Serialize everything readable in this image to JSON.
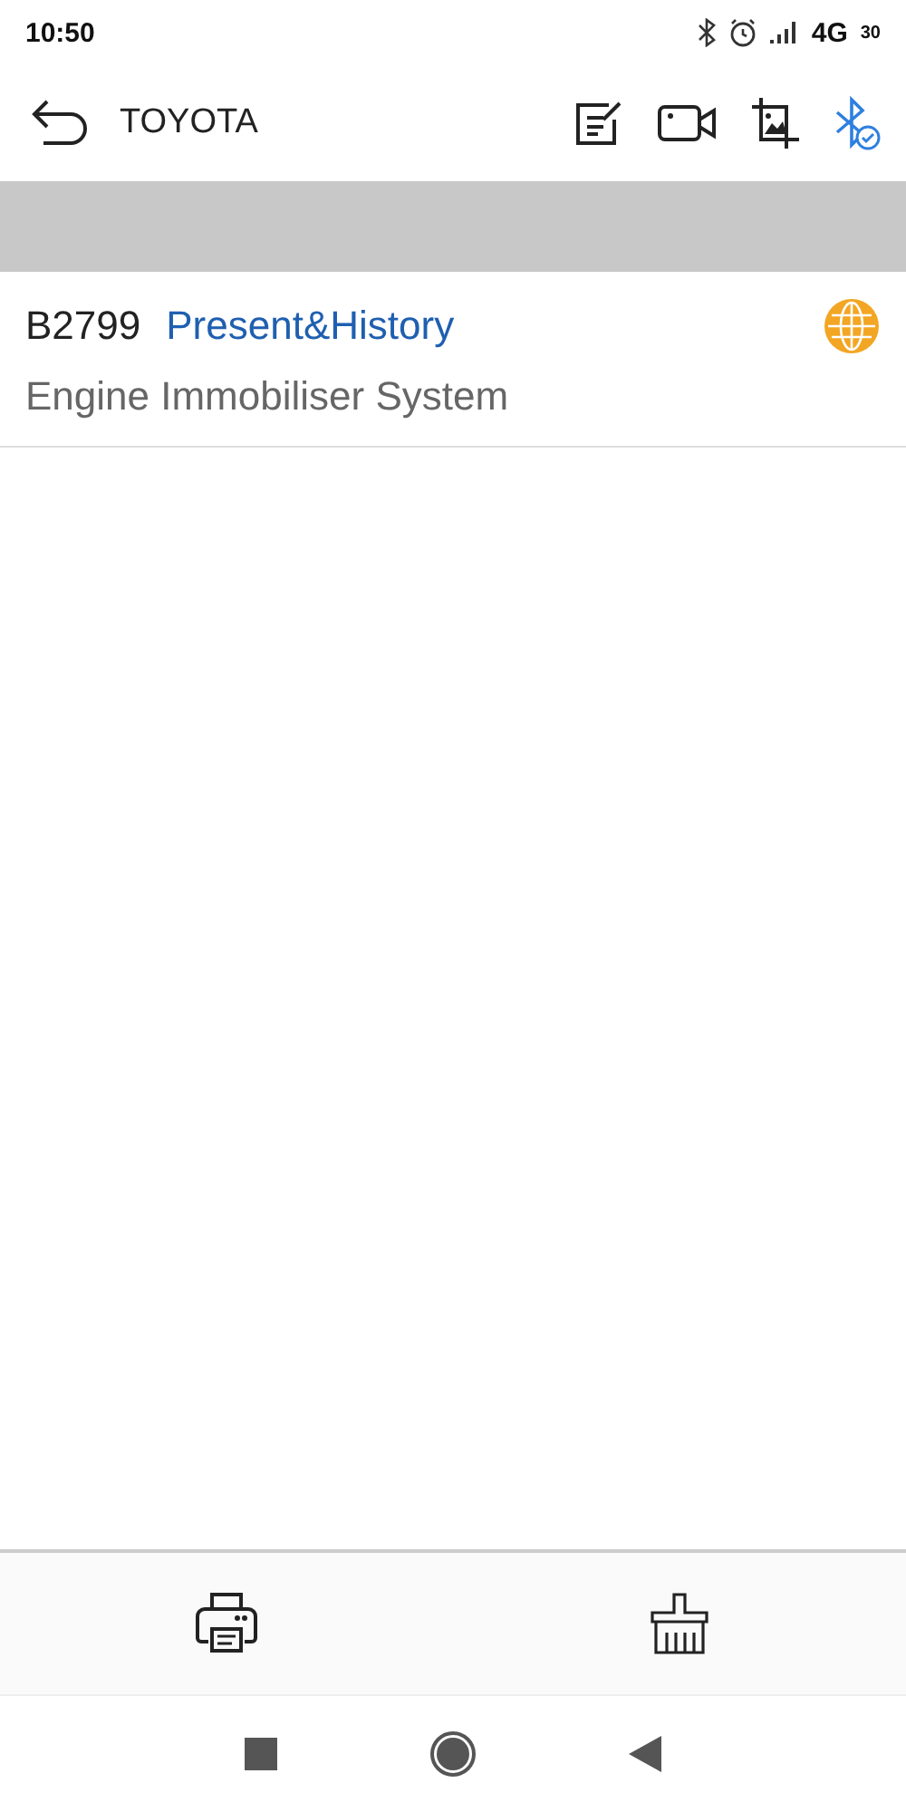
{
  "status_bar": {
    "time": "10:50",
    "network": "4G",
    "battery": "30"
  },
  "toolbar": {
    "title": "TOYOTA",
    "bluetooth_connected": true
  },
  "faults": [
    {
      "code": "B2799",
      "status": "Present&History",
      "system": "Engine Immobiliser System"
    }
  ]
}
